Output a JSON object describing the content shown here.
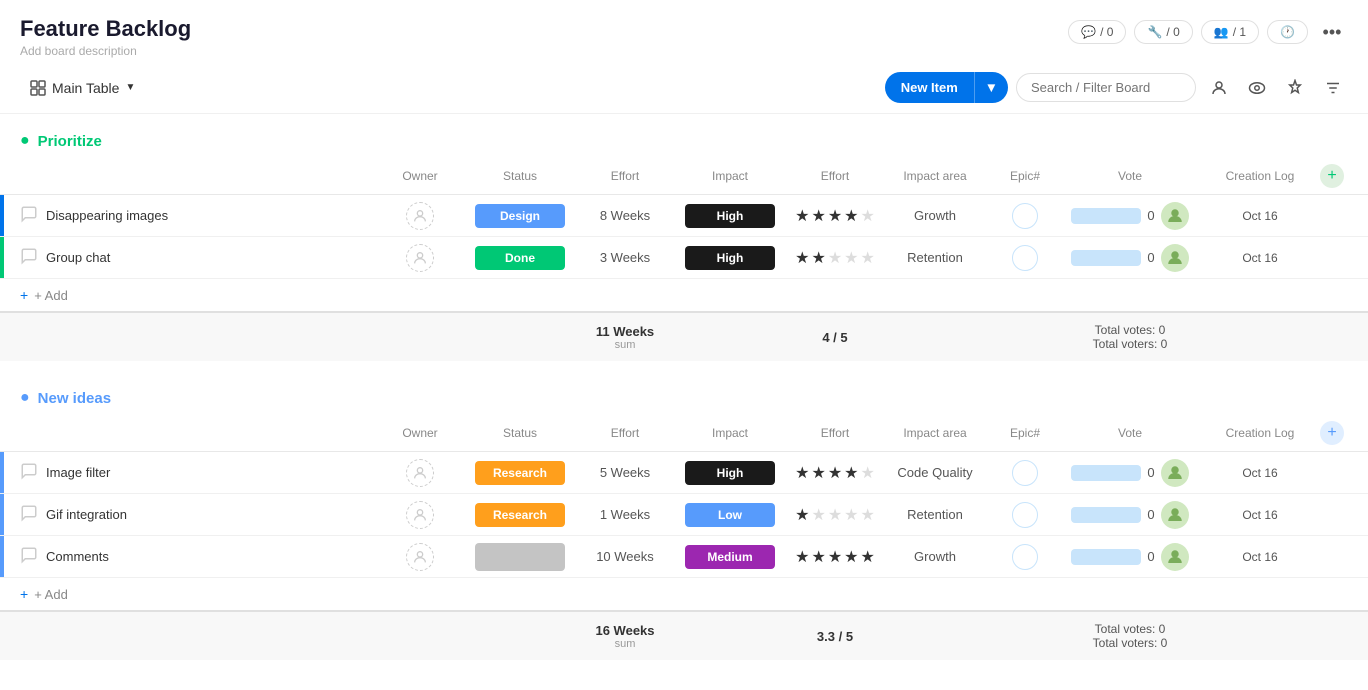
{
  "app": {
    "title": "Feature Backlog",
    "description": "Add board description"
  },
  "header": {
    "stats": [
      {
        "icon": "💬",
        "value": "/ 0"
      },
      {
        "icon": "🔧",
        "value": "/ 0"
      },
      {
        "icon": "👥",
        "value": "/ 1"
      }
    ],
    "more_icon": "..."
  },
  "toolbar": {
    "main_table_label": "Main Table",
    "new_item_label": "New Item",
    "search_placeholder": "Search / Filter Board"
  },
  "groups": [
    {
      "id": "prioritize",
      "title": "Prioritize",
      "color": "green",
      "columns": {
        "name": "",
        "owner": "Owner",
        "status": "Status",
        "effort": "Effort",
        "impact": "Impact",
        "effort2": "Effort",
        "impact_area": "Impact area",
        "epic": "Epic#",
        "vote": "Vote",
        "creation_log": "Creation Log"
      },
      "rows": [
        {
          "name": "Disappearing images",
          "owner": "",
          "status": "Design",
          "status_class": "status-design",
          "effort": "8 Weeks",
          "impact": "High",
          "impact_class": "impact-high",
          "stars": 4,
          "impact_area": "Growth",
          "vote_count": "0",
          "date": "Oct 16"
        },
        {
          "name": "Group chat",
          "owner": "",
          "status": "Done",
          "status_class": "status-done",
          "effort": "3 Weeks",
          "impact": "High",
          "impact_class": "impact-high",
          "stars": 2,
          "impact_area": "Retention",
          "vote_count": "0",
          "date": "Oct 16"
        }
      ],
      "summary": {
        "effort_total": "11 Weeks",
        "effort_label": "sum",
        "impact_score": "4 / 5",
        "total_votes": "Total votes: 0",
        "total_voters": "Total voters: 0"
      }
    },
    {
      "id": "new-ideas",
      "title": "New ideas",
      "color": "blue",
      "columns": {
        "name": "",
        "owner": "Owner",
        "status": "Status",
        "effort": "Effort",
        "impact": "Impact",
        "effort2": "Effort",
        "impact_area": "Impact area",
        "epic": "Epic#",
        "vote": "Vote",
        "creation_log": "Creation Log"
      },
      "rows": [
        {
          "name": "Image filter",
          "owner": "",
          "status": "Research",
          "status_class": "status-research",
          "effort": "5 Weeks",
          "impact": "High",
          "impact_class": "impact-high",
          "stars": 4,
          "impact_area": "Code Quality",
          "vote_count": "0",
          "date": "Oct 16"
        },
        {
          "name": "Gif integration",
          "owner": "",
          "status": "Research",
          "status_class": "status-research",
          "effort": "1 Weeks",
          "impact": "Low",
          "impact_class": "impact-low",
          "stars": 1,
          "impact_area": "Retention",
          "vote_count": "0",
          "date": "Oct 16"
        },
        {
          "name": "Comments",
          "owner": "",
          "status": "",
          "status_class": "status-empty",
          "effort": "10 Weeks",
          "impact": "Medium",
          "impact_class": "impact-medium",
          "stars": 5,
          "impact_area": "Growth",
          "vote_count": "0",
          "date": "Oct 16"
        }
      ],
      "summary": {
        "effort_total": "16 Weeks",
        "effort_label": "sum",
        "impact_score": "3.3 / 5",
        "total_votes": "Total votes: 0",
        "total_voters": "Total voters: 0"
      }
    }
  ]
}
